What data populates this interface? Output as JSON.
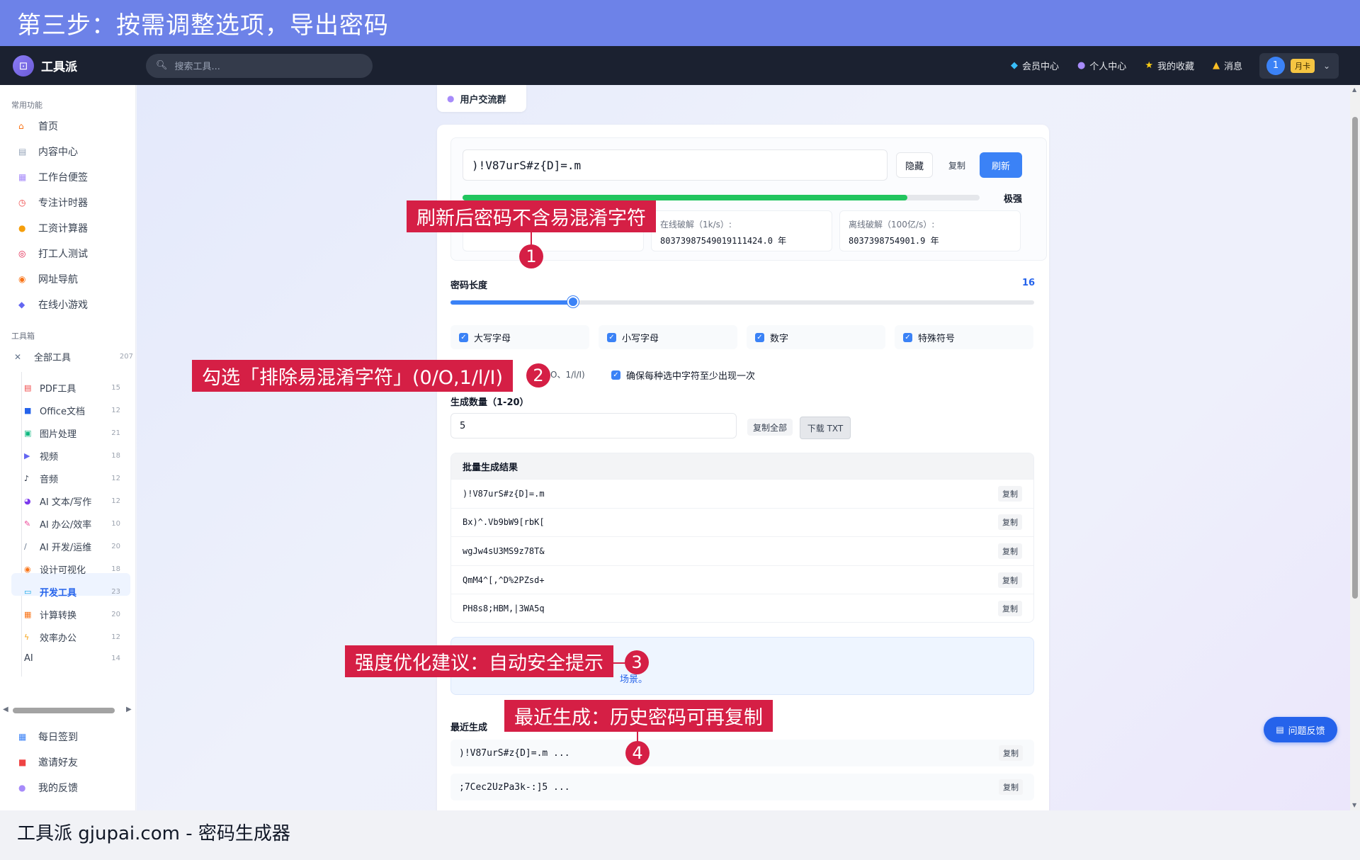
{
  "banner": {
    "title": "第三步：按需调整选项，导出密码"
  },
  "appbar": {
    "logo_text": "工具派",
    "search_placeholder": "搜索工具...",
    "nav": [
      {
        "label": "会员中心",
        "icon": "diamond-icon"
      },
      {
        "label": "个人中心",
        "icon": "user-icon"
      },
      {
        "label": "我的收藏",
        "icon": "star-icon"
      },
      {
        "label": "消息",
        "icon": "bell-icon"
      }
    ],
    "user_avatar": "1",
    "user_badge": "月卡"
  },
  "sidebar": {
    "common_title": "常用功能",
    "common": [
      {
        "label": "首页",
        "icon": "home-icon"
      },
      {
        "label": "内容中心",
        "icon": "content-icon"
      },
      {
        "label": "工作台便签",
        "icon": "note-icon"
      },
      {
        "label": "专注计时器",
        "icon": "timer-icon"
      },
      {
        "label": "工资计算器",
        "icon": "money-bag-icon"
      },
      {
        "label": "打工人测试",
        "icon": "target-icon"
      },
      {
        "label": "网址导航",
        "icon": "compass-icon"
      },
      {
        "label": "在线小游戏",
        "icon": "gamepad-icon"
      }
    ],
    "toolbox_title": "工具箱",
    "all_tools": {
      "label": "全部工具",
      "count": "207"
    },
    "tree": [
      {
        "label": "PDF工具",
        "count": "15",
        "icon": "pdf-icon"
      },
      {
        "label": "Office文档",
        "count": "12",
        "icon": "office-icon"
      },
      {
        "label": "图片处理",
        "count": "21",
        "icon": "image-icon"
      },
      {
        "label": "视频",
        "count": "18",
        "icon": "video-icon"
      },
      {
        "label": "音频",
        "count": "12",
        "icon": "music-icon"
      },
      {
        "label": "AI 文本/写作",
        "count": "12",
        "icon": "ai-writing-icon"
      },
      {
        "label": "AI 办公/效率",
        "count": "10",
        "icon": "ai-office-icon"
      },
      {
        "label": "AI 开发/运维",
        "count": "20",
        "icon": "ai-dev-icon"
      },
      {
        "label": "设计可视化",
        "count": "18",
        "icon": "palette-icon"
      },
      {
        "label": "开发工具",
        "count": "23",
        "icon": "laptop-icon"
      },
      {
        "label": "计算转换",
        "count": "20",
        "icon": "calculator-icon"
      },
      {
        "label": "效率办公",
        "count": "12",
        "icon": "lightning-icon"
      },
      {
        "label": "AI",
        "count": "14",
        "icon": ""
      }
    ],
    "bottom": [
      {
        "label": "每日签到",
        "icon": "calendar-icon"
      },
      {
        "label": "邀请好友",
        "icon": "gift-icon"
      },
      {
        "label": "我的反馈",
        "icon": "chat-icon"
      }
    ]
  },
  "main": {
    "group_chip": "用户交流群",
    "password": ")!V87urS#z{D]=.m",
    "hide_label": "隐藏",
    "copy_label": "复制",
    "refresh_label": "刷新",
    "strength_percent": 86,
    "strength_label": "极强",
    "crack_online_title": "在线破解（1k/s）:",
    "crack_online_value": "80373987549019111424.0 年",
    "crack_offline_title": "离线破解（100亿/s）:",
    "crack_offline_value": "8037398754901.9 年",
    "length_label": "密码长度",
    "length_value": "16",
    "length_fraction": 0.21,
    "options": [
      "大写字母",
      "小写字母",
      "数字",
      "特殊符号"
    ],
    "exclude_tail": "O、1/l/I)",
    "ensure_each": "确保每种选中字符至少出现一次",
    "count_label": "生成数量（1-20）",
    "count_value": "5",
    "copy_all": "复制全部",
    "download_txt": "下载 TXT",
    "batch_title": "批量生成结果",
    "batch": [
      ")!V87urS#z{D]=.m",
      "Bx)^.Vb9bW9[rbK[",
      "wgJw4sU3MS9z78T&",
      "QmM4^[,^D%2PZsd+",
      "PH8s8;HBM,|3WA5q"
    ],
    "tip_text": "场景。",
    "recent_title": "最近生成",
    "recent": [
      ")!V87urS#z{D]=.m ...",
      ";7Cec2UzPa3k-:]5 ..."
    ]
  },
  "feedback": "问题反馈",
  "callouts": [
    {
      "text": "刷新后密码不含易混淆字符",
      "num": "1"
    },
    {
      "text": "勾选「排除易混淆字符」(0/O,1/l/I)",
      "num": "2"
    },
    {
      "text": "强度优化建议：自动安全提示",
      "num": "3"
    },
    {
      "text": "最近生成：历史密码可再复制",
      "num": "4"
    }
  ],
  "footer": "工具派 gjupai.com - 密码生成器"
}
